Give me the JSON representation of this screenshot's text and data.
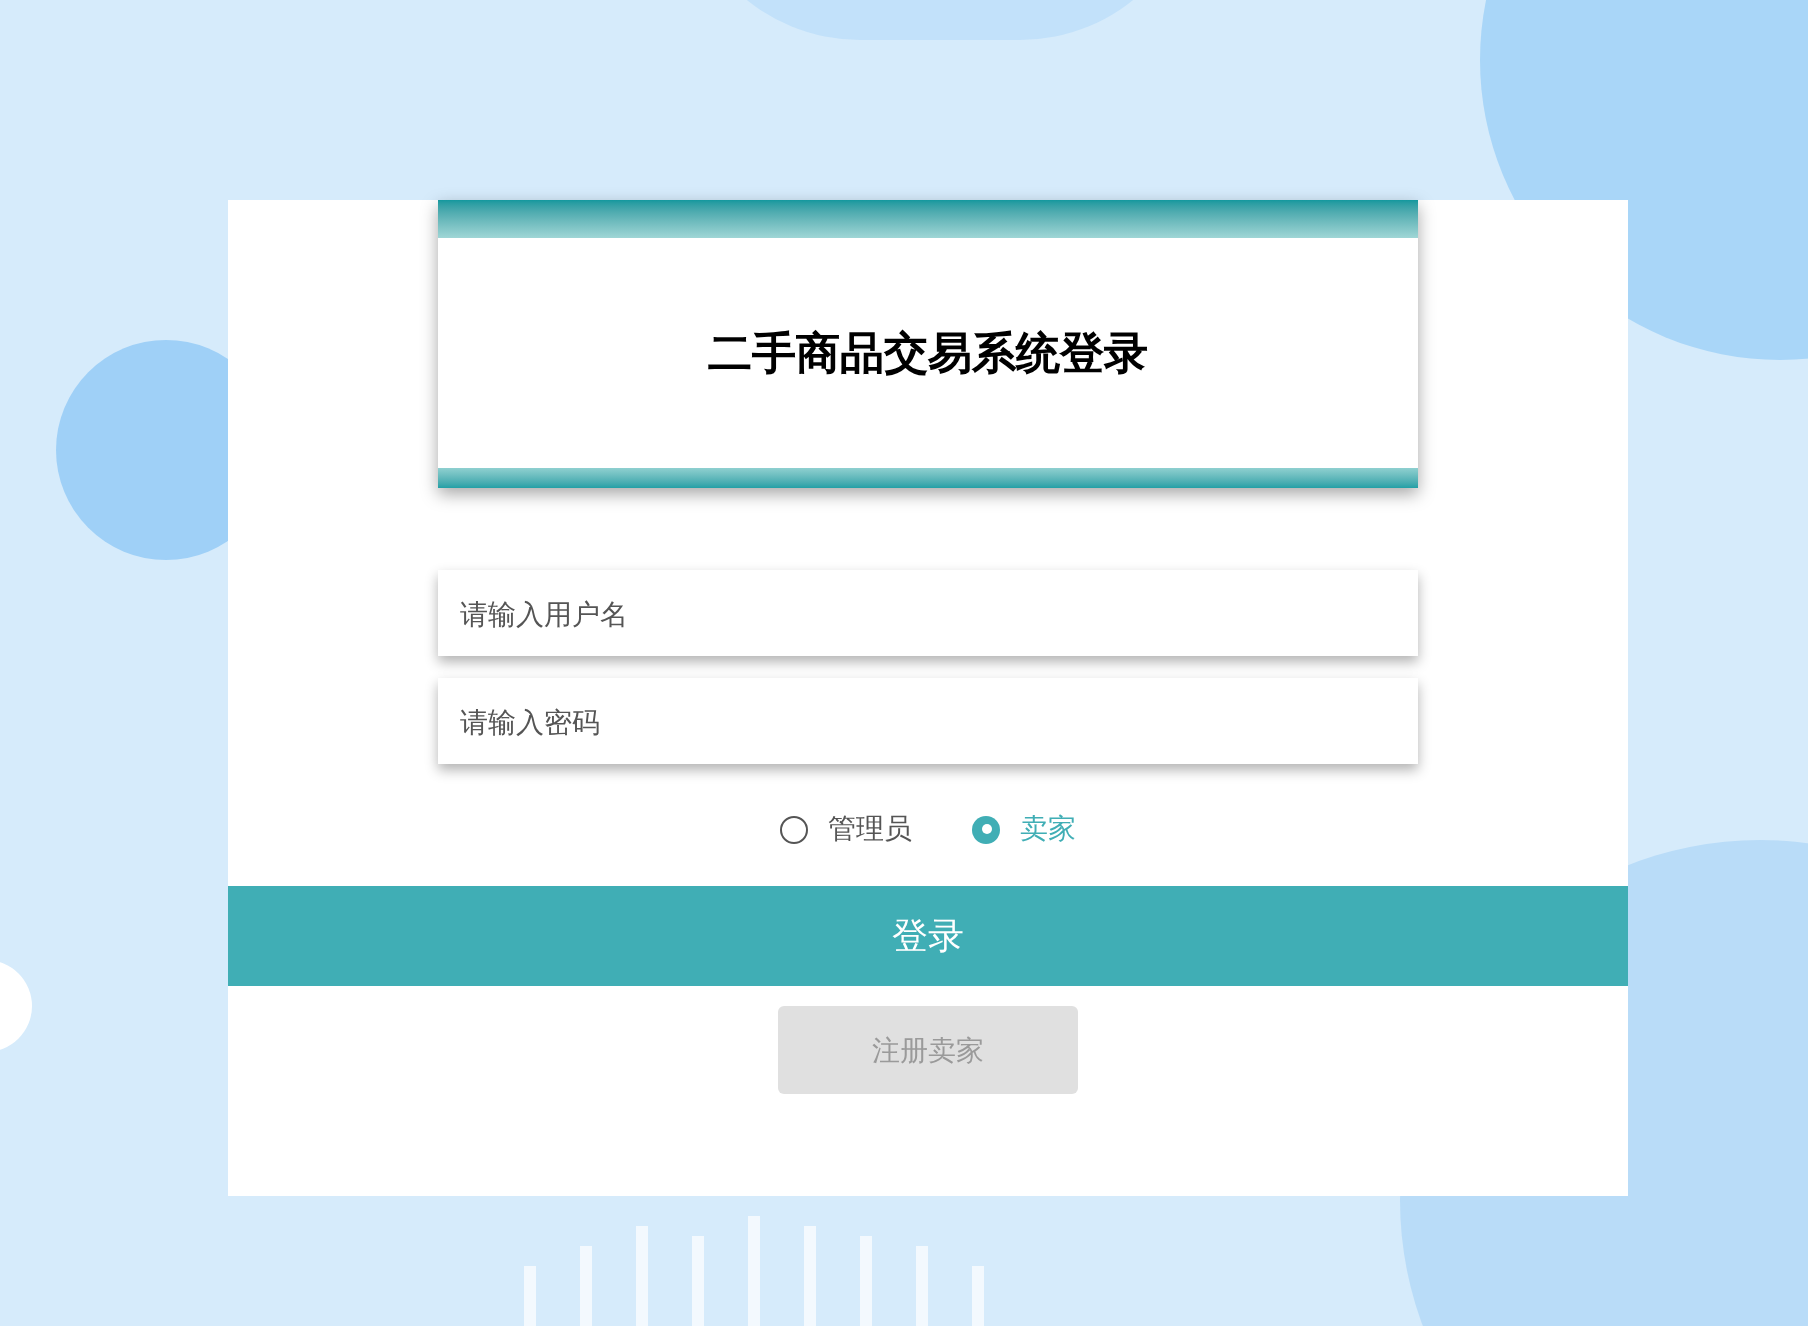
{
  "title": "二手商品交易系统登录",
  "fields": [
    {
      "placeholder": "请输入用户名"
    },
    {
      "placeholder": "请输入密码"
    }
  ],
  "roles": [
    {
      "label": "管理员",
      "selected": false
    },
    {
      "label": "卖家",
      "selected": true
    }
  ],
  "login_button": "登录",
  "register_button": "注册卖家"
}
